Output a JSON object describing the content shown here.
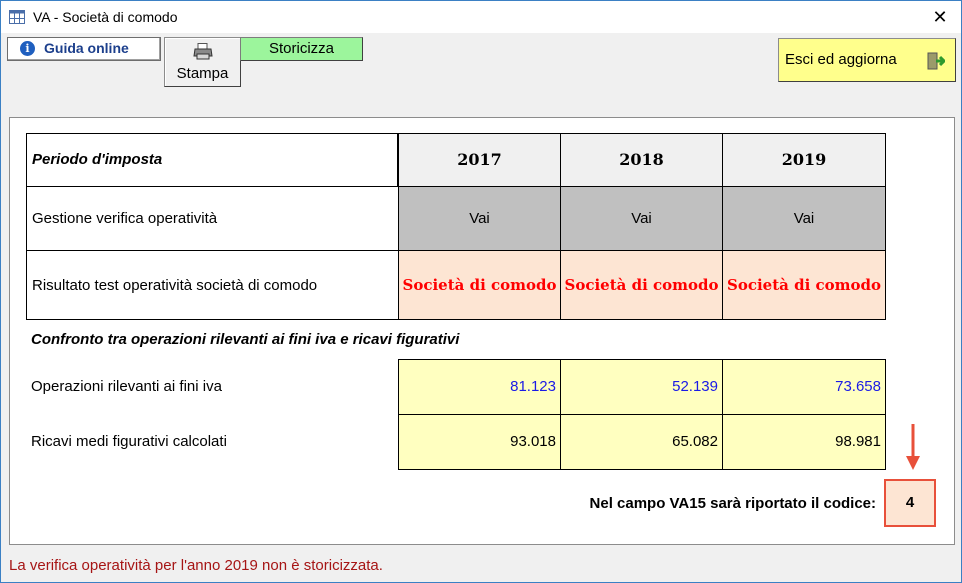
{
  "window": {
    "title": "VA - Società di comodo"
  },
  "toolbar": {
    "guida_label": "Guida online",
    "stampa_label": "Stampa",
    "storicizza_label": "Storicizza",
    "esci_label": "Esci ed aggiorna"
  },
  "table": {
    "period_header": "Periodo d'imposta",
    "years": [
      "2017",
      "2018",
      "2019"
    ],
    "row_gestione_label": "Gestione verifica operatività",
    "vai_labels": [
      "Vai",
      "Vai",
      "Vai"
    ],
    "row_risultato_label": "Risultato test operatività società di comodo",
    "risultati": [
      "Società di comodo",
      "Società di comodo",
      "Società di comodo"
    ],
    "confronto_header": "Confronto tra operazioni rilevanti ai fini iva e ricavi figurativi",
    "row_operazioni_label": "Operazioni rilevanti ai fini iva",
    "operazioni": [
      "81.123",
      "52.139",
      "73.658"
    ],
    "row_ricavi_label": "Ricavi medi figurativi calcolati",
    "ricavi": [
      "93.018",
      "65.082",
      "98.981"
    ]
  },
  "code": {
    "label": "Nel campo VA15 sarà riportato il codice:",
    "value": "4"
  },
  "status_text": "La verifica operatività per l'anno 2019 non è storicizzata.",
  "colors": {
    "storicizza_bg": "#9cf59c",
    "esci_bg": "#ffff8c",
    "result_text": "#ff0000",
    "yellow_cell": "#ffffc0",
    "peach_cell": "#fde5d3",
    "status_text": "#a61515",
    "highlight_border": "#e8503a"
  }
}
